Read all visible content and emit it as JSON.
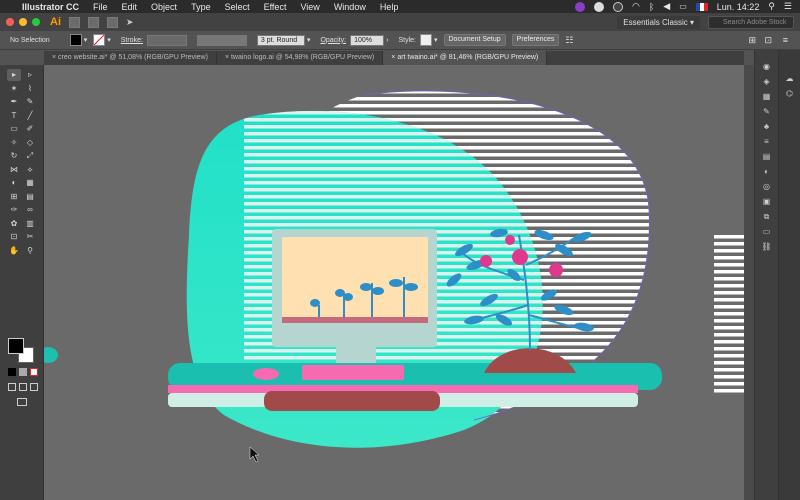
{
  "menubar": {
    "apple": "",
    "app_name": "Illustrator CC",
    "items": [
      "File",
      "Edit",
      "Object",
      "Type",
      "Select",
      "Effect",
      "View",
      "Window",
      "Help"
    ],
    "clock": "Lun. 14:22",
    "flag_colors": [
      "#1f4bb0",
      "#ffffff",
      "#d8262b"
    ]
  },
  "appbar": {
    "logo": "Ai",
    "workspace": "Essentials Classic",
    "search_placeholder": "Search Adobe Stock"
  },
  "control": {
    "selection": "No Selection",
    "stroke_label": "Stroke:",
    "stroke_style": "3 pt. Round",
    "opacity_label": "Opacity:",
    "opacity_value": "100%",
    "style_label": "Style:",
    "doc_setup": "Document Setup",
    "preferences": "Preferences"
  },
  "tabs": [
    {
      "label": "creo website.ai* @ 51,08% (RGB/GPU Preview)",
      "close": "×"
    },
    {
      "label": "twaino logo.ai @ 54,98% (RGB/GPU Preview)",
      "close": "×"
    },
    {
      "label": "art twaino.ai* @ 81,46% (RGB/GPU Preview)",
      "close": "×"
    }
  ],
  "tools": [
    "selection-icon",
    "direct-selection-icon",
    "magic-wand-icon",
    "lasso-icon",
    "pen-icon",
    "curvature-icon",
    "type-icon",
    "line-icon",
    "rectangle-icon",
    "paintbrush-icon",
    "shaper-icon",
    "eraser-icon",
    "rotate-icon",
    "scale-icon",
    "width-icon",
    "free-transform-icon",
    "shape-builder-icon",
    "perspective-icon",
    "mesh-icon",
    "gradient-icon",
    "eyedropper-icon",
    "blend-icon",
    "symbol-sprayer-icon",
    "graph-icon",
    "artboard-icon",
    "slice-icon",
    "hand-icon",
    "zoom-icon"
  ],
  "tool_glyphs": [
    "▸",
    "▹",
    "✶",
    "⌇",
    "✒",
    "✎",
    "T",
    "╱",
    "▭",
    "✐",
    "✧",
    "◇",
    "↻",
    "⤢",
    "⋈",
    "⟡",
    "◐",
    "▦",
    "⊞",
    "▤",
    "✑",
    "∞",
    "✿",
    "▥",
    "⊡",
    "✂",
    "✋",
    "⚲"
  ],
  "panel_icons": [
    "color-icon",
    "color-guide-icon",
    "swatches-icon",
    "brushes-icon",
    "symbols-icon",
    "stroke-icon",
    "gradient-panel-icon",
    "transparency-icon",
    "appearance-icon",
    "graphic-styles-icon",
    "layers-icon",
    "artboards-icon",
    "links-icon"
  ],
  "panel_glyphs": [
    "◉",
    "◈",
    "▦",
    "✎",
    "♣",
    "≡",
    "▤",
    "◐",
    "◎",
    "▣",
    "⧉",
    "▭",
    "⛓"
  ],
  "colors": {
    "teal": "#1fe0c8",
    "stripe": "#d9f3ef",
    "dark_bg": "#6a6a6a",
    "monitor_screen": "#ffe0b0",
    "plant_blue": "#2e8fc8",
    "tomato": "#e0388c",
    "pot": "#a04a4a",
    "desk_pink": "#f56ab0",
    "desk_teal": "#1bbfb0"
  }
}
